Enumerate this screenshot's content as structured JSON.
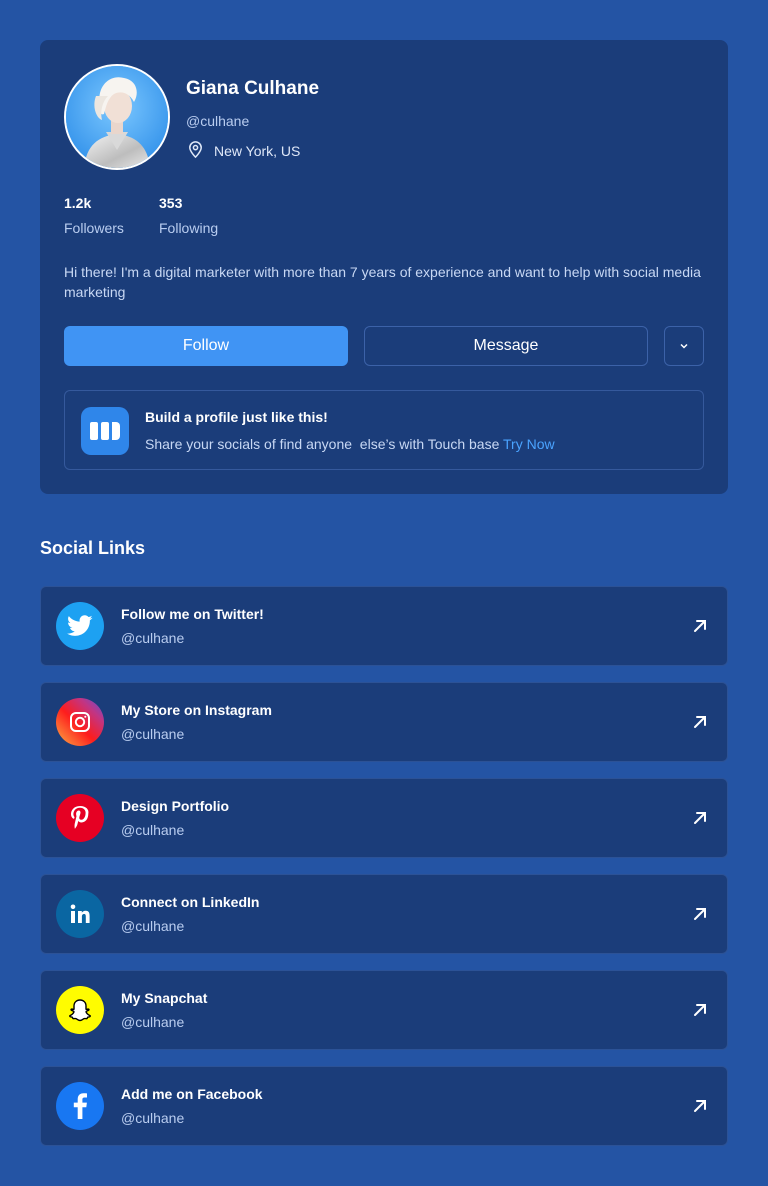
{
  "profile": {
    "name": "Giana Culhane",
    "handle": "@culhane",
    "location": "New York, US",
    "followers_count": "1.2k",
    "followers_label": "Followers",
    "following_count": "353",
    "following_label": "Following",
    "bio": "Hi there! I'm a digital marketer with more than 7 years of experience and want to help with social media marketing"
  },
  "actions": {
    "follow_label": "Follow",
    "message_label": "Message"
  },
  "promo": {
    "title": "Build a profile just like this!",
    "text": "Share your socials of find anyone  else’s with Touch base ",
    "link": "Try Now"
  },
  "social_section": {
    "title": "Social Links",
    "links": [
      {
        "title": "Follow me on Twitter!",
        "handle": "@culhane",
        "icon": "twitter-icon"
      },
      {
        "title": "My Store on Instagram",
        "handle": "@culhane",
        "icon": "instagram-icon"
      },
      {
        "title": "Design Portfolio",
        "handle": "@culhane",
        "icon": "pinterest-icon"
      },
      {
        "title": "Connect on LinkedIn",
        "handle": "@culhane",
        "icon": "linkedin-icon"
      },
      {
        "title": "My Snapchat",
        "handle": "@culhane",
        "icon": "snapchat-icon"
      },
      {
        "title": "Add me on Facebook",
        "handle": "@culhane",
        "icon": "facebook-icon"
      }
    ]
  },
  "colors": {
    "background": "#2454a4",
    "card": "#1b3d7a",
    "accent": "#4094f4",
    "link": "#4aa3ff"
  }
}
